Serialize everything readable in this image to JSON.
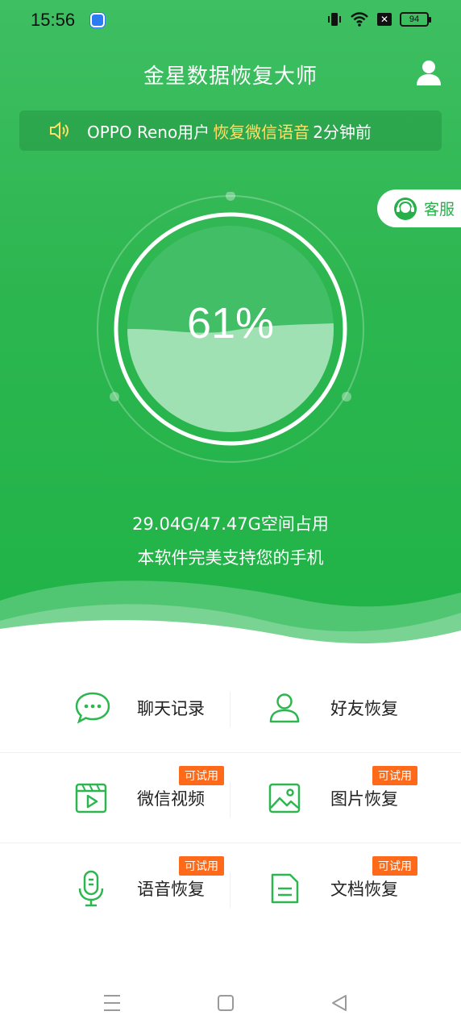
{
  "status": {
    "time": "15:56",
    "battery": "94"
  },
  "header": {
    "title": "金星数据恢复大师"
  },
  "ticker": {
    "prefix": "OPPO Reno用户",
    "highlight": "恢复微信语音",
    "suffix": "2分钟前"
  },
  "service": {
    "label": "客服"
  },
  "gauge": {
    "percent_text": "61%",
    "percent_value": 61
  },
  "storage": {
    "space_text": "29.04G/47.47G空间占用",
    "support_text": "本软件完美支持您的手机"
  },
  "features": [
    {
      "label": "聊天记录",
      "tag": "",
      "icon": "chat-bubble-icon"
    },
    {
      "label": "好友恢复",
      "tag": "",
      "icon": "person-icon"
    },
    {
      "label": "微信视频",
      "tag": "可试用",
      "icon": "video-icon"
    },
    {
      "label": "图片恢复",
      "tag": "可试用",
      "icon": "image-icon"
    },
    {
      "label": "语音恢复",
      "tag": "可试用",
      "icon": "microphone-icon"
    },
    {
      "label": "文档恢复",
      "tag": "可试用",
      "icon": "document-icon"
    }
  ],
  "colors": {
    "primary": "#2db650",
    "tag": "#ff6a1a",
    "highlight": "#ffe066"
  }
}
